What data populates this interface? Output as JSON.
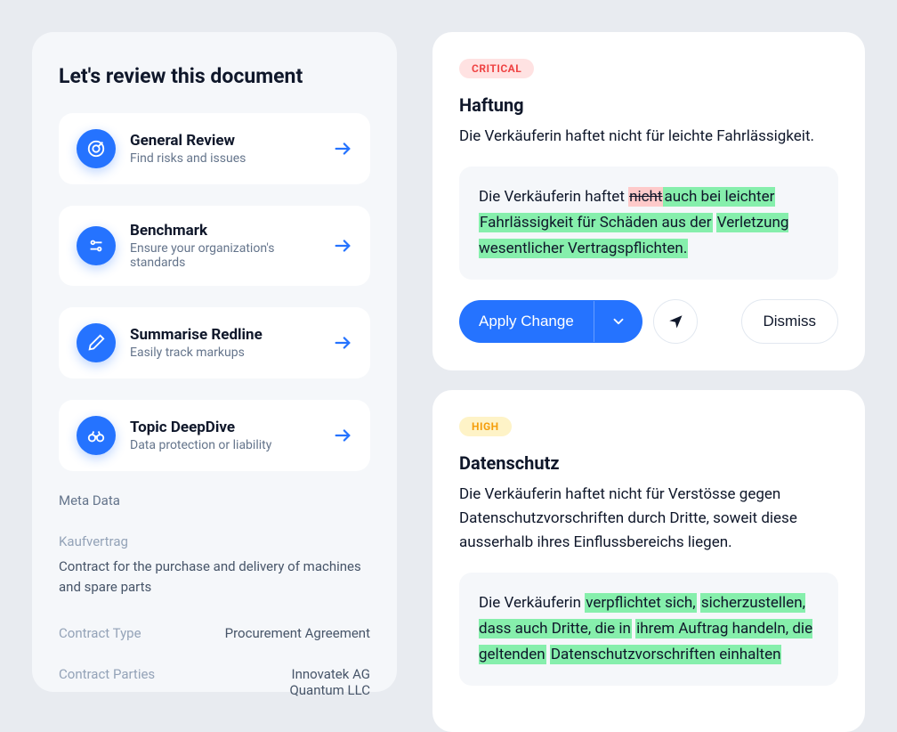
{
  "left": {
    "title": "Let's review this document",
    "actions": [
      {
        "title": "General Review",
        "subtitle": "Find risks and issues",
        "icon": "target"
      },
      {
        "title": "Benchmark",
        "subtitle": "Ensure your organization's standards",
        "icon": "sliders"
      },
      {
        "title": "Summarise Redline",
        "subtitle": "Easily track markups",
        "icon": "pencil"
      },
      {
        "title": "Topic DeepDive",
        "subtitle": "Data protection or liability",
        "icon": "binoculars"
      }
    ],
    "meta": {
      "heading": "Meta Data",
      "docTypeLabel": "Kaufvertrag",
      "description": "Contract for the purchase and delivery of machines and spare parts",
      "rows": [
        {
          "label": "Contract Type",
          "value": "Procurement Agreement"
        },
        {
          "label": "Contract Parties",
          "value": "Innovatek AG\nQuantum LLC"
        }
      ]
    }
  },
  "issues": [
    {
      "severity": "CRITICAL",
      "title": "Haftung",
      "text": "Die Verkäuferin haftet nicht für leichte Fahrlässigkeit.",
      "diff": {
        "prefix": "Die Verkäuferin haftet ",
        "strike": "nicht",
        "added1": "auch bei leichter",
        "mid": " ",
        "added2": "Fahrlässigkeit für Schäden aus der",
        "mid2": " ",
        "added3": "Verletzung wesentlicher Vertragspflichten."
      },
      "buttons": {
        "apply": "Apply Change",
        "dismiss": "Dismiss"
      }
    },
    {
      "severity": "HIGH",
      "title": "Datenschutz",
      "text": "Die Verkäuferin haftet nicht für Verstösse gegen Datenschutzvorschriften durch Dritte, soweit diese ausserhalb ihres Einflussbereichs liegen.",
      "diff": {
        "prefix": "Die Verkäuferin ",
        "added1": "verpflichtet sich,",
        "mid": " ",
        "added2": "sicherzustellen, dass auch Dritte, die in",
        "mid2": " ",
        "added3": "ihrem Auftrag handeln, die geltenden",
        "mid3": " ",
        "added4": "Datenschutzvorschriften einhalten"
      }
    }
  ]
}
